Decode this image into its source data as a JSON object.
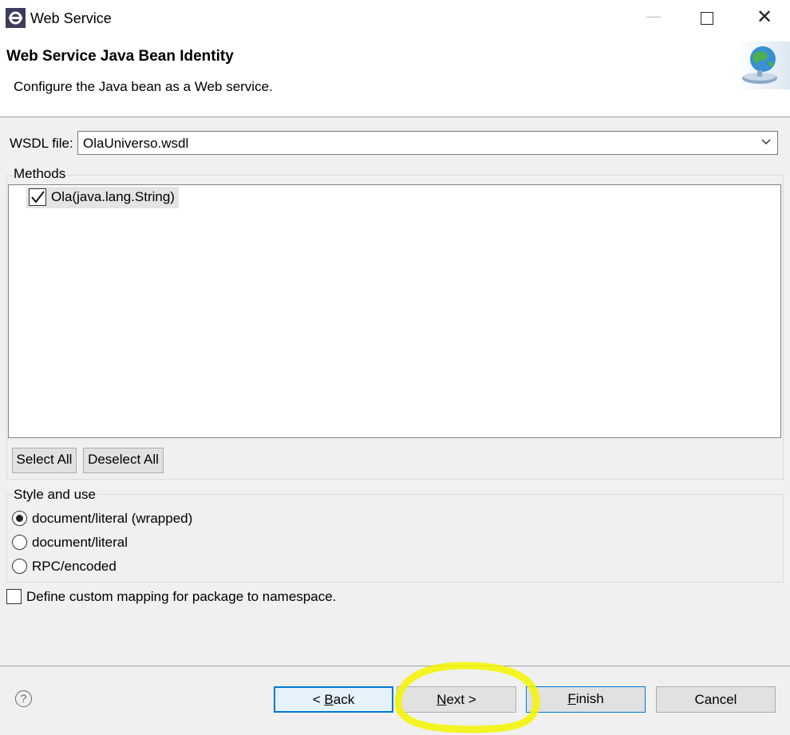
{
  "window": {
    "title": "Web Service",
    "icon": "eclipse-icon",
    "controls": [
      "minimize-icon",
      "maximize-icon",
      "close-icon"
    ]
  },
  "banner": {
    "title": "Web Service Java Bean Identity",
    "description": "Configure the Java bean as a Web service.",
    "image": "web-service-globe-icon"
  },
  "wsdl": {
    "label": "WSDL file:",
    "value": "OlaUniverso.wsdl"
  },
  "methods": {
    "legend": "Methods",
    "items": [
      {
        "label": "Ola(java.lang.String)",
        "checked": true
      }
    ],
    "select_all": "Select All",
    "deselect_all": "Deselect All"
  },
  "style_and_use": {
    "legend": "Style and use",
    "options": [
      {
        "label": "document/literal (wrapped)",
        "selected": true
      },
      {
        "label": "document/literal",
        "selected": false
      },
      {
        "label": "RPC/encoded",
        "selected": false
      }
    ]
  },
  "custom_mapping": {
    "label": "Define custom mapping for package to namespace.",
    "checked": false
  },
  "footer": {
    "help": "?",
    "back_prefix": "< ",
    "back_mnemonic": "B",
    "back_rest": "ack",
    "next_mnemonic": "N",
    "next_rest": "ext >",
    "finish_mnemonic": "F",
    "finish_rest": "inish",
    "cancel": "Cancel"
  },
  "colors": {
    "focus_blue": "#0078d7",
    "annotation_highlight": "#f4f400"
  }
}
